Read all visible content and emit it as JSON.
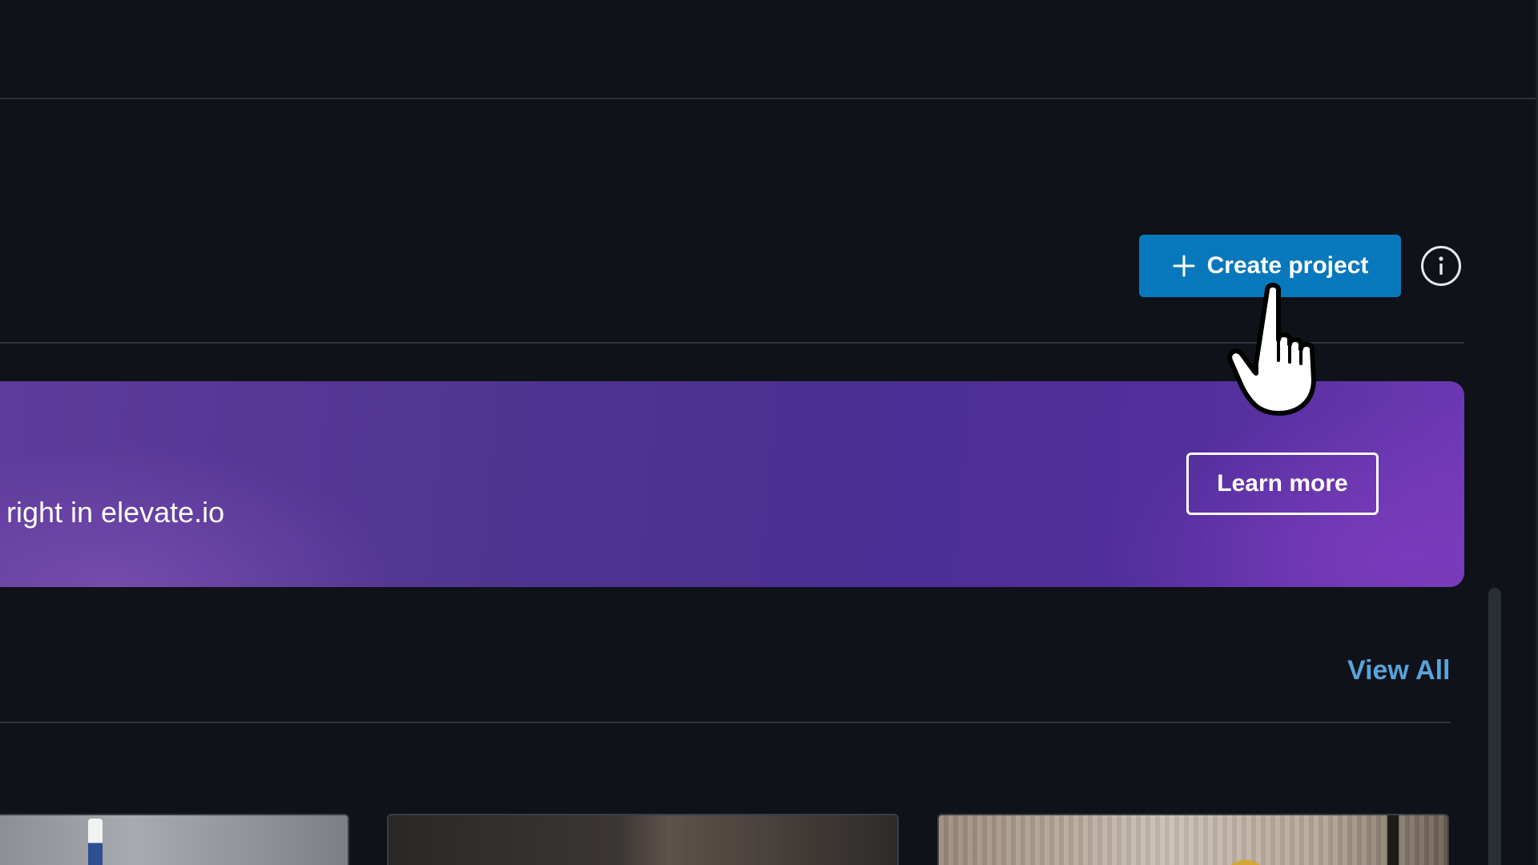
{
  "header": {
    "create_button_label": "Create project",
    "create_button_icon": "plus-icon",
    "info_icon": "info-icon",
    "accent_color": "#0878bd"
  },
  "banner": {
    "text": "s right in elevate.io",
    "learn_more_label": "Learn more",
    "gradient_colors": [
      "#5e3b9c",
      "#4a2f93",
      "#6e39b3"
    ]
  },
  "section": {
    "view_all_label": "View All",
    "link_color": "#5aa2db"
  },
  "cursor": {
    "icon": "pointer-hand-cursor-icon"
  }
}
